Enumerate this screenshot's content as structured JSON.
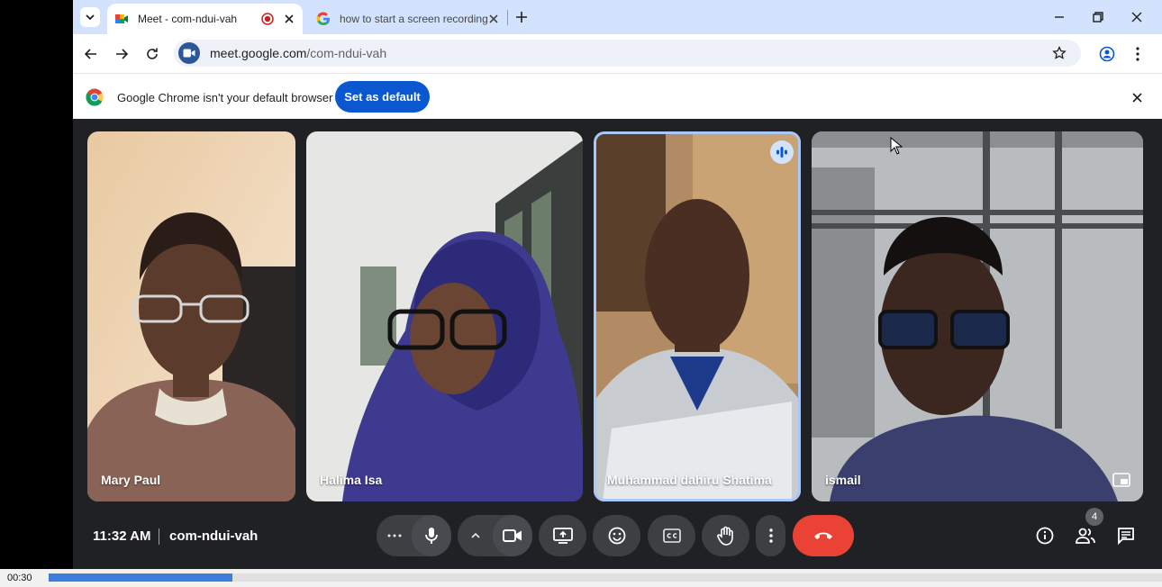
{
  "browser": {
    "tabs": [
      {
        "title": "Meet - com-ndui-vah",
        "active": true,
        "recording": true
      },
      {
        "title": "how to start a screen recording",
        "active": false
      }
    ],
    "url_host": "meet.google.com",
    "url_path": "/com-ndui-vah"
  },
  "infobar": {
    "message": "Google Chrome isn't your default browser",
    "button_label": "Set as default"
  },
  "meeting": {
    "time": "11:32 AM",
    "code": "com-ndui-vah",
    "participant_count": "4",
    "participants": [
      {
        "name": "Mary Paul"
      },
      {
        "name": "Halima Isa"
      },
      {
        "name": "Muhammad dahiru Shatima",
        "speaking": true
      },
      {
        "name": "ismail"
      }
    ]
  },
  "recorder": {
    "elapsed": "00:30",
    "progress": 0.165
  },
  "colors": {
    "accent": "#0b57d0",
    "hangup": "#ea4335",
    "speaking_ring": "#a8c7fa",
    "meet_bg": "#202124"
  }
}
